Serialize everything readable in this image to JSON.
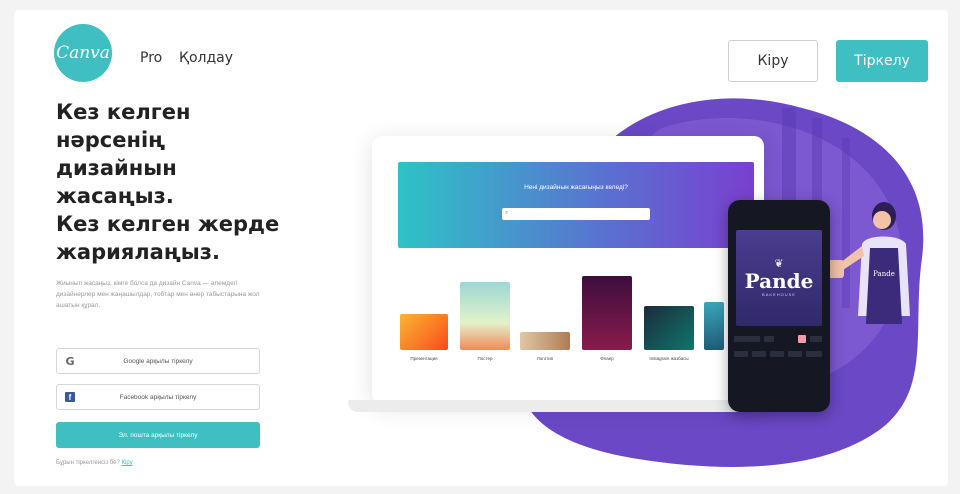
{
  "brand": {
    "logo_text": "Canva",
    "accent": "#3fbfc1"
  },
  "nav": {
    "pro": "Pro",
    "help": "Қолдау"
  },
  "header": {
    "login_label": "Кіру",
    "signup_label": "Тіркелу"
  },
  "hero": {
    "headline_lines": [
      "Кез келген",
      "нәрсенің",
      "дизайнын",
      "жасаңыз.",
      "Кез келген жерде",
      "жариялаңыз."
    ],
    "description": "Жиынып жасаңыз, кімге болса да дизайн Canva — әлемдегі дизайнерлер мен жаңашылдар, тобтар мен өнер табыстарына жол ашатын құрал."
  },
  "auth": {
    "google_label": "Google арқылы тіркелу",
    "facebook_label": "Facebook арқылы тіркелу",
    "email_label": "Эл. пошта арқылы тіркелу",
    "login_prompt": "Бұрын тіркелгенсіз бе?",
    "login_link": "Кіру"
  },
  "editor_preview": {
    "banner_title": "Нені дизайнын жасағыңыз келеді?",
    "search_icon": "search-icon",
    "templates": [
      "Презентация",
      "Постер",
      "Логотип",
      "Флаер",
      "Instagram жазбасы"
    ],
    "phone_card": {
      "title": "Pande",
      "subtitle": "BAKEHOUSE"
    }
  }
}
